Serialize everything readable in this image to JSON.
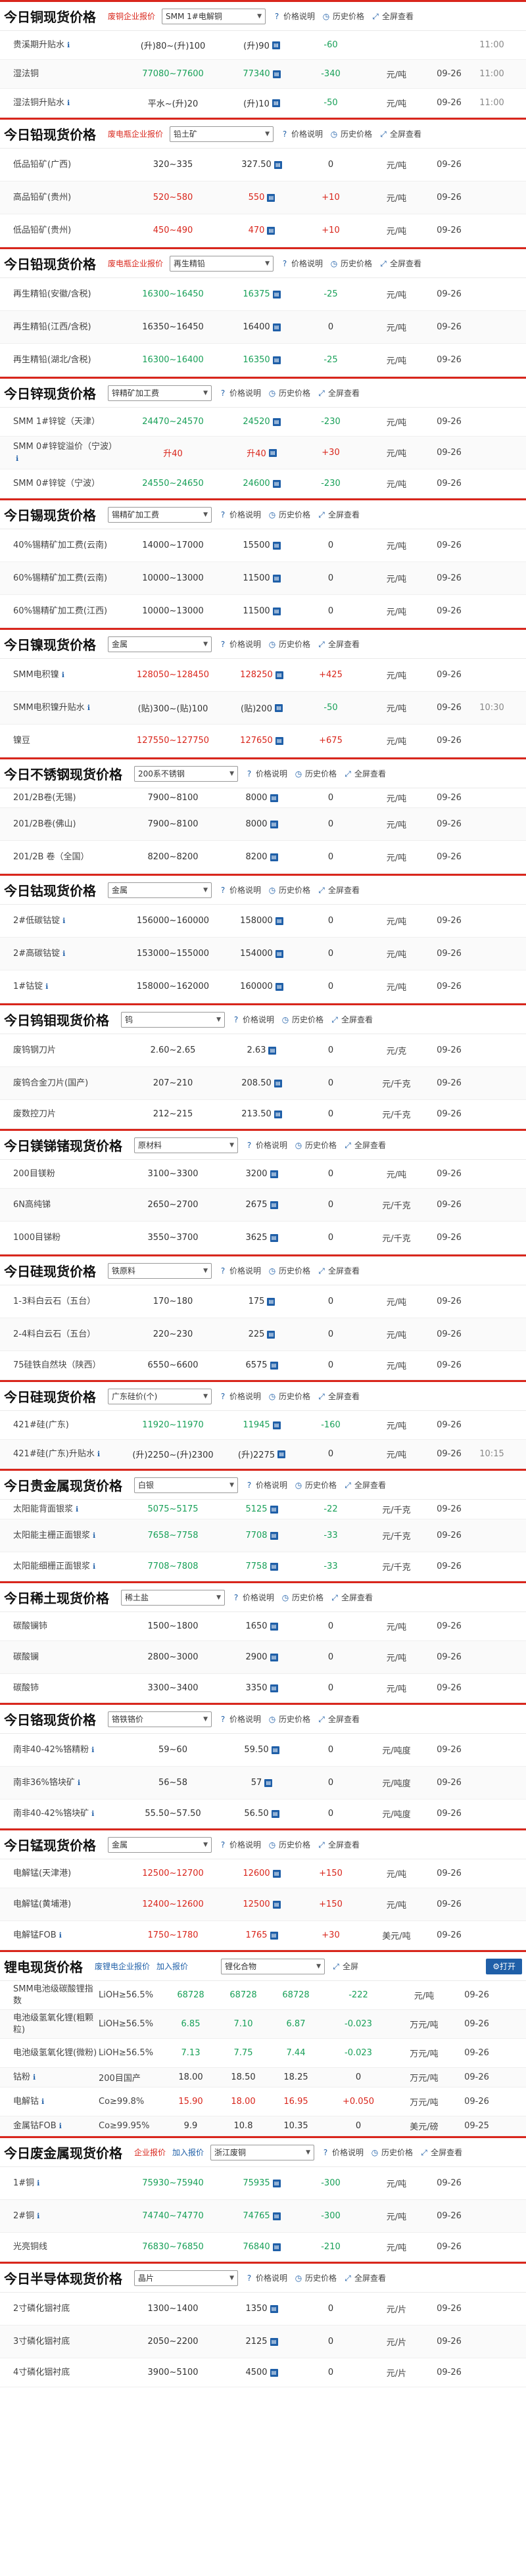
{
  "common": {
    "price_desc": "价格说明",
    "history": "历史价格",
    "fullscreen": "全屏查看",
    "info": "ℹ"
  },
  "sections": [
    {
      "id": "cu",
      "title": "今日铜现货价格",
      "link": "废铜企业报价",
      "select": "SMM 1#电解铜",
      "rows": [
        {
          "name": "贵溪期升贴水",
          "info": true,
          "range": "(升)80~(升)100",
          "avg": "(升)90",
          "chg": "-60",
          "dir": "down",
          "unit": "",
          "date": "",
          "time": "11:00",
          "h": 44
        },
        {
          "name": "湿法铜",
          "range": "77080~77600",
          "avg": "77340",
          "chg": "-340",
          "dir": "down",
          "unit": "元/吨",
          "date": "09-26",
          "time": "11:00",
          "h": 44,
          "rdir": "down"
        },
        {
          "name": "湿法铜升贴水",
          "info": true,
          "range": "平水~(升)20",
          "avg": "(升)10",
          "chg": "-50",
          "dir": "down",
          "unit": "元/吨",
          "date": "09-26",
          "time": "11:00",
          "h": 44
        }
      ]
    },
    {
      "id": "pbore",
      "title": "今日铅现货价格",
      "link": "废电瓶企业报价",
      "select": "铅土矿",
      "rows": [
        {
          "name": "低品铅矿(广西)",
          "range": "320~335",
          "avg": "327.50",
          "chg": "0",
          "dir": "flat",
          "unit": "元/吨",
          "date": "09-26",
          "time": "",
          "h": 50
        },
        {
          "name": "高品铅矿(贵州)",
          "range": "520~580",
          "avg": "550",
          "chg": "+10",
          "dir": "up",
          "unit": "元/吨",
          "date": "09-26",
          "time": "",
          "h": 50,
          "rdir": "up"
        },
        {
          "name": "低品铅矿(贵州)",
          "range": "450~490",
          "avg": "470",
          "chg": "+10",
          "dir": "up",
          "unit": "元/吨",
          "date": "09-26",
          "time": "",
          "h": 50,
          "rdir": "up"
        }
      ]
    },
    {
      "id": "pb",
      "title": "今日铅现货价格",
      "link": "废电瓶企业报价",
      "select": "再生精铅",
      "rows": [
        {
          "name": "再生精铅(安徽/含税)",
          "range": "16300~16450",
          "avg": "16375",
          "chg": "-25",
          "dir": "down",
          "unit": "元/吨",
          "date": "09-26",
          "time": "",
          "h": 50,
          "rdir": "down"
        },
        {
          "name": "再生精铅(江西/含税)",
          "range": "16350~16450",
          "avg": "16400",
          "chg": "0",
          "dir": "flat",
          "unit": "元/吨",
          "date": "09-26",
          "time": "",
          "h": 50
        },
        {
          "name": "再生精铅(湖北/含税)",
          "range": "16300~16400",
          "avg": "16350",
          "chg": "-25",
          "dir": "down",
          "unit": "元/吨",
          "date": "09-26",
          "time": "",
          "h": 50,
          "rdir": "down"
        }
      ]
    },
    {
      "id": "zn",
      "title": "今日锌现货价格",
      "link": "",
      "select": "锌精矿加工费",
      "rows": [
        {
          "name": "SMM 1#锌锭（天津）",
          "range": "24470~24570",
          "avg": "24520",
          "chg": "-230",
          "dir": "down",
          "unit": "元/吨",
          "date": "09-26",
          "time": "",
          "h": 44,
          "rdir": "down"
        },
        {
          "name": "SMM 0#锌锭溢价（宁波）",
          "info": true,
          "range": "升40",
          "avg": "升40",
          "chg": "+30",
          "dir": "up",
          "unit": "元/吨",
          "date": "09-26",
          "time": "",
          "h": 50,
          "rdir": "up"
        },
        {
          "name": "SMM 0#锌锭（宁波）",
          "range": "24550~24650",
          "avg": "24600",
          "chg": "-230",
          "dir": "down",
          "unit": "元/吨",
          "date": "09-26",
          "time": "",
          "h": 44,
          "rdir": "down"
        }
      ]
    },
    {
      "id": "sn",
      "title": "今日锡现货价格",
      "link": "",
      "select": "锡精矿加工费",
      "rows": [
        {
          "name": "40%锡精矿加工费(云南)",
          "range": "14000~17000",
          "avg": "15500",
          "chg": "0",
          "dir": "flat",
          "unit": "元/吨",
          "date": "09-26",
          "time": "",
          "h": 50
        },
        {
          "name": "60%锡精矿加工费(云南)",
          "range": "10000~13000",
          "avg": "11500",
          "chg": "0",
          "dir": "flat",
          "unit": "元/吨",
          "date": "09-26",
          "time": "",
          "h": 50
        },
        {
          "name": "60%锡精矿加工费(江西)",
          "range": "10000~13000",
          "avg": "11500",
          "chg": "0",
          "dir": "flat",
          "unit": "元/吨",
          "date": "09-26",
          "time": "",
          "h": 50
        }
      ]
    },
    {
      "id": "ni",
      "title": "今日镍现货价格",
      "link": "",
      "select": "金属",
      "rows": [
        {
          "name": "SMM电积镍",
          "info": true,
          "range": "128050~128450",
          "avg": "128250",
          "chg": "+425",
          "dir": "up",
          "unit": "元/吨",
          "date": "09-26",
          "time": "",
          "h": 50,
          "rdir": "up"
        },
        {
          "name": "SMM电积镍升贴水",
          "info": true,
          "range": "(贴)300~(贴)100",
          "avg": "(贴)200",
          "chg": "-50",
          "dir": "down",
          "unit": "元/吨",
          "date": "09-26",
          "time": "10:30",
          "h": 50
        },
        {
          "name": "镍豆",
          "range": "127550~127750",
          "avg": "127650",
          "chg": "+675",
          "dir": "up",
          "unit": "元/吨",
          "date": "09-26",
          "time": "",
          "h": 50,
          "rdir": "up"
        }
      ]
    },
    {
      "id": "ss",
      "title": "今日不锈钢现货价格",
      "link": "",
      "select": "200系不锈钢",
      "rows": [
        {
          "name": "201/2B卷(无锡)",
          "range": "7900~8100",
          "avg": "8000",
          "chg": "0",
          "dir": "flat",
          "unit": "元/吨",
          "date": "09-26",
          "time": "",
          "h": 30
        },
        {
          "name": "201/2B卷(佛山)",
          "range": "7900~8100",
          "avg": "8000",
          "chg": "0",
          "dir": "flat",
          "unit": "元/吨",
          "date": "09-26",
          "time": "",
          "h": 50
        },
        {
          "name": "201/2B 卷（全国）",
          "range": "8200~8200",
          "avg": "8200",
          "chg": "0",
          "dir": "flat",
          "unit": "元/吨",
          "date": "09-26",
          "time": "",
          "h": 50
        }
      ]
    },
    {
      "id": "co",
      "title": "今日钴现货价格",
      "link": "",
      "select": "金属",
      "rows": [
        {
          "name": "2#低碳钴锭",
          "info": true,
          "range": "156000~160000",
          "avg": "158000",
          "chg": "0",
          "dir": "flat",
          "unit": "元/吨",
          "date": "09-26",
          "time": "",
          "h": 50
        },
        {
          "name": "2#高碳钴锭",
          "info": true,
          "range": "153000~155000",
          "avg": "154000",
          "chg": "0",
          "dir": "flat",
          "unit": "元/吨",
          "date": "09-26",
          "time": "",
          "h": 50
        },
        {
          "name": "1#钴锭",
          "info": true,
          "range": "158000~162000",
          "avg": "160000",
          "chg": "0",
          "dir": "flat",
          "unit": "元/吨",
          "date": "09-26",
          "time": "",
          "h": 50
        }
      ]
    },
    {
      "id": "w",
      "title": "今日钨钼现货价格",
      "link": "",
      "select": "钨",
      "rows": [
        {
          "name": "废钨钢刀片",
          "range": "2.60~2.65",
          "avg": "2.63",
          "chg": "0",
          "dir": "flat",
          "unit": "元/克",
          "date": "09-26",
          "time": "",
          "h": 50
        },
        {
          "name": "废钨合金刀片(国产)",
          "range": "207~210",
          "avg": "208.50",
          "chg": "0",
          "dir": "flat",
          "unit": "元/千克",
          "date": "09-26",
          "time": "",
          "h": 50
        },
        {
          "name": "废数控刀片",
          "range": "212~215",
          "avg": "213.50",
          "chg": "0",
          "dir": "flat",
          "unit": "元/千克",
          "date": "09-26",
          "time": "",
          "h": 44
        }
      ]
    },
    {
      "id": "mg",
      "title": "今日镁锑锗现货价格",
      "link": "",
      "select": "原材料",
      "rows": [
        {
          "name": "200目镁粉",
          "range": "3100~3300",
          "avg": "3200",
          "chg": "0",
          "dir": "flat",
          "unit": "元/吨",
          "date": "09-26",
          "time": "",
          "h": 44
        },
        {
          "name": "6N高纯锑",
          "range": "2650~2700",
          "avg": "2675",
          "chg": "0",
          "dir": "flat",
          "unit": "元/千克",
          "date": "09-26",
          "time": "",
          "h": 50
        },
        {
          "name": "1000目锑粉",
          "range": "3550~3700",
          "avg": "3625",
          "chg": "0",
          "dir": "flat",
          "unit": "元/千克",
          "date": "09-26",
          "time": "",
          "h": 50
        }
      ]
    },
    {
      "id": "si",
      "title": "今日硅现货价格",
      "link": "",
      "select": "铁原料",
      "rows": [
        {
          "name": "1-3料白云石（五台）",
          "range": "170~180",
          "avg": "175",
          "chg": "0",
          "dir": "flat",
          "unit": "元/吨",
          "date": "09-26",
          "time": "",
          "h": 50
        },
        {
          "name": "2-4料白云石（五台）",
          "range": "220~230",
          "avg": "225",
          "chg": "0",
          "dir": "flat",
          "unit": "元/吨",
          "date": "09-26",
          "time": "",
          "h": 50
        },
        {
          "name": "75硅铁自然块（陕西）",
          "range": "6550~6600",
          "avg": "6575",
          "chg": "0",
          "dir": "flat",
          "unit": "元/吨",
          "date": "09-26",
          "time": "",
          "h": 44
        }
      ]
    },
    {
      "id": "si2",
      "title": "今日硅现货价格",
      "link": "",
      "select": "广东硅价(个)",
      "rows": [
        {
          "name": "421#硅(广东)",
          "range": "11920~11970",
          "avg": "11945",
          "chg": "-160",
          "dir": "down",
          "unit": "元/吨",
          "date": "09-26",
          "time": "",
          "h": 44,
          "rdir": "down"
        },
        {
          "name": "421#硅(广东)升贴水",
          "info": true,
          "range": "(升)2250~(升)2300",
          "avg": "(升)2275",
          "chg": "0",
          "dir": "flat",
          "unit": "元/吨",
          "date": "09-26",
          "time": "10:15",
          "h": 44
        }
      ]
    },
    {
      "id": "ag",
      "title": "今日贵金属现货价格",
      "link": "",
      "select": "白银",
      "rows": [
        {
          "name": "太阳能背面银浆",
          "info": true,
          "range": "5075~5175",
          "avg": "5125",
          "chg": "-22",
          "dir": "down",
          "unit": "元/千克",
          "date": "09-26",
          "time": "",
          "h": 30,
          "rdir": "down"
        },
        {
          "name": "太阳能主栅正面银浆",
          "info": true,
          "range": "7658~7758",
          "avg": "7708",
          "chg": "-33",
          "dir": "down",
          "unit": "元/千克",
          "date": "09-26",
          "time": "",
          "h": 50,
          "rdir": "down"
        },
        {
          "name": "太阳能细栅正面银浆",
          "info": true,
          "range": "7708~7808",
          "avg": "7758",
          "chg": "-33",
          "dir": "down",
          "unit": "元/千克",
          "date": "09-26",
          "time": "",
          "h": 44,
          "rdir": "down"
        }
      ]
    },
    {
      "id": "re",
      "title": "今日稀土现货价格",
      "link": "",
      "select": "稀土盐",
      "rows": [
        {
          "name": "碳酸镧铈",
          "range": "1500~1800",
          "avg": "1650",
          "chg": "0",
          "dir": "flat",
          "unit": "元/吨",
          "date": "09-26",
          "time": "",
          "h": 44
        },
        {
          "name": "碳酸镧",
          "range": "2800~3000",
          "avg": "2900",
          "chg": "0",
          "dir": "flat",
          "unit": "元/吨",
          "date": "09-26",
          "time": "",
          "h": 50
        },
        {
          "name": "碳酸铈",
          "range": "3300~3400",
          "avg": "3350",
          "chg": "0",
          "dir": "flat",
          "unit": "元/吨",
          "date": "09-26",
          "time": "",
          "h": 44
        }
      ]
    },
    {
      "id": "cr",
      "title": "今日铬现货价格",
      "link": "",
      "select": "铬铁铬价",
      "rows": [
        {
          "name": "南非40-42%铬精粉",
          "info": true,
          "range": "59~60",
          "avg": "59.50",
          "chg": "0",
          "dir": "flat",
          "unit": "元/吨度",
          "date": "09-26",
          "time": "",
          "h": 50
        },
        {
          "name": "南非36%铬块矿",
          "info": true,
          "range": "56~58",
          "avg": "57",
          "chg": "0",
          "dir": "flat",
          "unit": "元/吨度",
          "date": "09-26",
          "time": "",
          "h": 50
        },
        {
          "name": "南非40-42%铬块矿",
          "info": true,
          "range": "55.50~57.50",
          "avg": "56.50",
          "chg": "0",
          "dir": "flat",
          "unit": "元/吨度",
          "date": "09-26",
          "time": "",
          "h": 44
        }
      ]
    },
    {
      "id": "mn",
      "title": "今日锰现货价格",
      "link": "",
      "select": "金属",
      "rows": [
        {
          "name": "电解锰(天津港)",
          "range": "12500~12700",
          "avg": "12600",
          "chg": "+150",
          "dir": "up",
          "unit": "元/吨",
          "date": "09-26",
          "time": "",
          "h": 44,
          "rdir": "up"
        },
        {
          "name": "电解锰(黄埔港)",
          "range": "12400~12600",
          "avg": "12500",
          "chg": "+150",
          "dir": "up",
          "unit": "元/吨",
          "date": "09-26",
          "time": "",
          "h": 50,
          "rdir": "up"
        },
        {
          "name": "电解锰FOB",
          "info": true,
          "range": "1750~1780",
          "avg": "1765",
          "chg": "+30",
          "dir": "up",
          "unit": "美元/吨",
          "date": "09-26",
          "time": "",
          "h": 44,
          "rdir": "up"
        }
      ]
    }
  ],
  "lithium": {
    "title": "锂电现货价格",
    "link1": "废锂电企业报价",
    "link2": "加入报价",
    "select": "锂化合物",
    "fullscreen": "全屏",
    "open": "打开",
    "rows": [
      {
        "name": "SMM电池级碳酸锂指数",
        "spec": "LiOH≥56.5%",
        "v1": "68728",
        "v2": "68728",
        "v3": "68728",
        "chg": "-222",
        "dir": "down",
        "unit": "元/吨",
        "date": "09-26",
        "h": 44
      },
      {
        "name": "电池级氢氧化锂(粗颗粒)",
        "spec": "LiOH≥56.5%",
        "v1": "6.85",
        "v2": "7.10",
        "v3": "6.87",
        "chg": "-0.023",
        "dir": "down",
        "unit": "万元/吨",
        "date": "09-26",
        "h": 44
      },
      {
        "name": "电池级氢氧化锂(微粉)",
        "spec": "LiOH≥56.5%",
        "v1": "7.13",
        "v2": "7.75",
        "v3": "7.44",
        "chg": "-0.023",
        "dir": "down",
        "unit": "万元/吨",
        "date": "09-26",
        "h": 44
      },
      {
        "name": "钴粉",
        "info": true,
        "spec": "200目国产",
        "v1": "18.00",
        "v2": "18.50",
        "v3": "18.25",
        "chg": "0",
        "dir": "flat",
        "unit": "万元/吨",
        "date": "09-26",
        "h": 30
      },
      {
        "name": "电解钴",
        "info": true,
        "spec": "Co≥99.8%",
        "v1": "15.90",
        "v2": "18.00",
        "v3": "16.95",
        "chg": "+0.050",
        "dir": "up",
        "unit": "万元/吨",
        "date": "09-26",
        "h": 44
      },
      {
        "name": "金属钴FOB",
        "info": true,
        "spec": "Co≥99.95%",
        "v1": "9.9",
        "v2": "10.8",
        "v3": "10.35",
        "chg": "0",
        "dir": "flat",
        "unit": "美元/磅",
        "date": "09-25",
        "h": 30
      }
    ]
  },
  "tail_sections": [
    {
      "id": "cu2",
      "title": "今日废金属现货价格",
      "link": "企业报价",
      "link2": "加入报价",
      "select": "浙江废铜",
      "rows": [
        {
          "name": "1#铜",
          "info": true,
          "range": "75930~75940",
          "avg": "75935",
          "chg": "-300",
          "dir": "down",
          "unit": "元/吨",
          "date": "09-26",
          "time": "",
          "h": 50,
          "rdir": "down"
        },
        {
          "name": "2#铜",
          "info": true,
          "range": "74740~74770",
          "avg": "74765",
          "chg": "-300",
          "dir": "down",
          "unit": "元/吨",
          "date": "09-26",
          "time": "",
          "h": 50,
          "rdir": "down"
        },
        {
          "name": "光亮铜线",
          "range": "76830~76850",
          "avg": "76840",
          "chg": "-210",
          "dir": "down",
          "unit": "元/吨",
          "date": "09-26",
          "time": "",
          "h": 44,
          "rdir": "down"
        }
      ]
    },
    {
      "id": "semi",
      "title": "今日半导体现货价格",
      "link": "",
      "select": "晶片",
      "rows": [
        {
          "name": "2寸磷化铟衬底",
          "range": "1300~1400",
          "avg": "1350",
          "chg": "0",
          "dir": "flat",
          "unit": "元/片",
          "date": "09-26",
          "time": "",
          "h": 50
        },
        {
          "name": "3寸磷化铟衬底",
          "range": "2050~2200",
          "avg": "2125",
          "chg": "0",
          "dir": "flat",
          "unit": "元/片",
          "date": "09-26",
          "time": "",
          "h": 50
        },
        {
          "name": "4寸磷化铟衬底",
          "range": "3900~5100",
          "avg": "4500",
          "chg": "0",
          "dir": "flat",
          "unit": "元/片",
          "date": "09-26",
          "time": "",
          "h": 44
        }
      ]
    }
  ]
}
